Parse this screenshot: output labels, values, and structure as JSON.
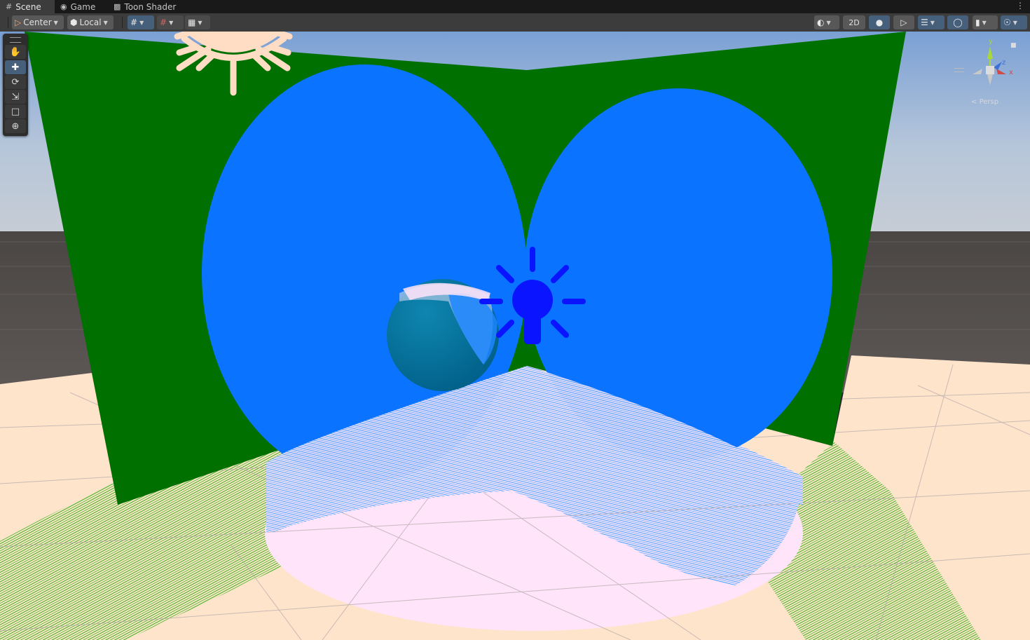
{
  "tabs": [
    {
      "label": "Scene",
      "icon": "grid-icon",
      "active": true
    },
    {
      "label": "Game",
      "icon": "gamepad-icon",
      "active": false
    },
    {
      "label": "Toon Shader",
      "icon": "shader-icon",
      "active": false
    }
  ],
  "toolbar": {
    "pivot_mode": "Center",
    "pivot_rotation": "Local",
    "mode_2d": "2D"
  },
  "tools": [
    {
      "name": "hand-tool",
      "icon": "hand-icon"
    },
    {
      "name": "move-tool",
      "icon": "move-icon"
    },
    {
      "name": "rotate-tool",
      "icon": "rotate-icon"
    },
    {
      "name": "scale-tool",
      "icon": "scale-icon"
    },
    {
      "name": "rect-tool",
      "icon": "rect-icon"
    },
    {
      "name": "transform-tool",
      "icon": "transform-icon"
    }
  ],
  "gizmo": {
    "y_label": "y",
    "z_label": "z",
    "x_label": "x",
    "projection": "Persp"
  },
  "colors": {
    "backdrop": "#007000",
    "spotlight": "#0a73ff",
    "light_icon": "#0a14ff",
    "sun_icon": "#ffdcc4",
    "floor": "#ffe4cc",
    "floor_light": "#ffe4fa",
    "hatch_green": "#3fb51f",
    "hatch_blue": "#3aa0ff",
    "toolbar_active": "#46607c"
  }
}
